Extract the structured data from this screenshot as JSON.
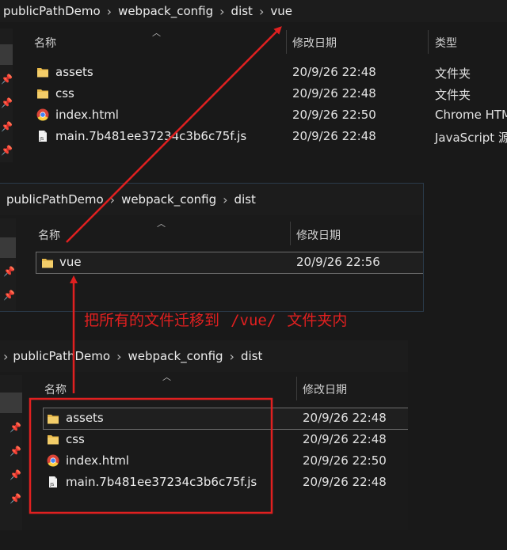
{
  "window_a": {
    "breadcrumb": [
      "publicPathDemo",
      "webpack_config",
      "dist",
      "vue"
    ],
    "columns": {
      "name": "名称",
      "date": "修改日期",
      "type": "类型"
    },
    "rows": [
      {
        "icon": "folder-icon",
        "name": "assets",
        "date": "20/9/26 22:48",
        "type": "文件夹"
      },
      {
        "icon": "folder-icon",
        "name": "css",
        "date": "20/9/26 22:48",
        "type": "文件夹"
      },
      {
        "icon": "chrome-icon",
        "name": "index.html",
        "date": "20/9/26 22:50",
        "type": "Chrome HTM"
      },
      {
        "icon": "js-file-icon",
        "name": "main.7b481ee37234c3b6c75f.js",
        "date": "20/9/26 22:48",
        "type": "JavaScript 源"
      }
    ]
  },
  "window_b": {
    "breadcrumb": [
      "publicPathDemo",
      "webpack_config",
      "dist"
    ],
    "columns": {
      "name": "名称",
      "date": "修改日期"
    },
    "rows": [
      {
        "icon": "folder-icon",
        "name": "vue",
        "date": "20/9/26 22:56"
      }
    ]
  },
  "window_c": {
    "breadcrumb": [
      "publicPathDemo",
      "webpack_config",
      "dist"
    ],
    "columns": {
      "name": "名称",
      "date": "修改日期"
    },
    "rows": [
      {
        "icon": "folder-icon",
        "name": "assets",
        "date": "20/9/26 22:48"
      },
      {
        "icon": "folder-icon",
        "name": "css",
        "date": "20/9/26 22:48"
      },
      {
        "icon": "chrome-icon",
        "name": "index.html",
        "date": "20/9/26 22:50"
      },
      {
        "icon": "js-file-icon",
        "name": "main.7b481ee37234c3b6c75f.js",
        "date": "20/9/26 22:48"
      }
    ]
  },
  "annotation": {
    "prefix": "把所有的文件迁移到",
    "path": "/vue/",
    "suffix": "文件夹内",
    "color": "#e02020"
  },
  "colors": {
    "background": "#191919",
    "folder": "#e8b94a",
    "arrow": "#e02020"
  }
}
